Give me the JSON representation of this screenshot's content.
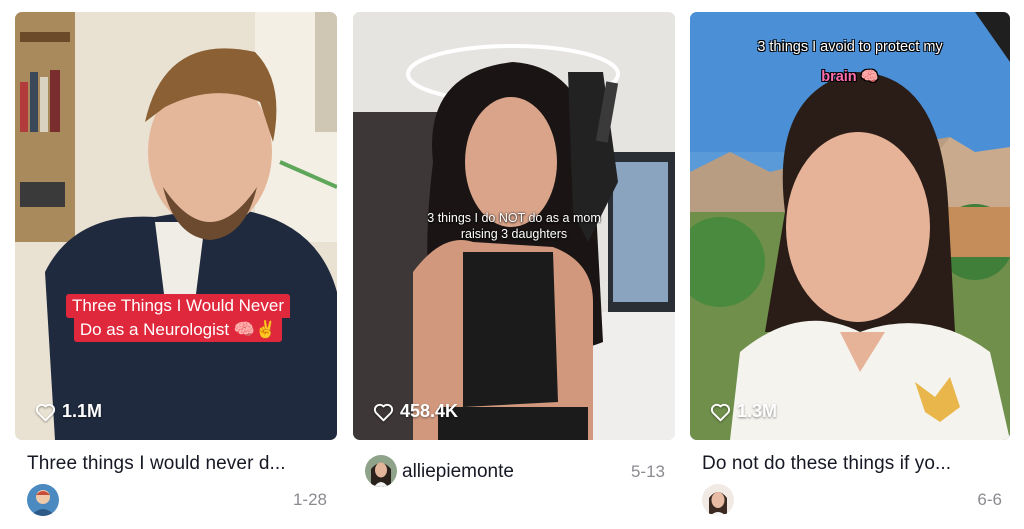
{
  "videos": [
    {
      "likes": "1.1M",
      "overlay_line1": "Three Things I Would Never",
      "overlay_line2": "Do as a Neurologist 🧠✌️",
      "title": "Three things I would never d...",
      "date": "1-28"
    },
    {
      "likes": "458.4K",
      "overlay_line1": "3 things I do NOT do as a mom",
      "overlay_line2": "raising 3 daughters",
      "username": "alliepiemonte",
      "date": "5-13"
    },
    {
      "likes": "1.3M",
      "overlay_line1": "3 things I avoid to protect my",
      "overlay_line2": "brain 🧠",
      "title": "Do not do these things if yo...",
      "date": "6-6"
    }
  ],
  "colors": {
    "caption_red": "#e0283d",
    "text_primary": "#161823",
    "text_secondary": "#8a8b91",
    "highlight_pink": "#ff6fb0"
  },
  "icons": [
    "heart-outline-icon"
  ]
}
